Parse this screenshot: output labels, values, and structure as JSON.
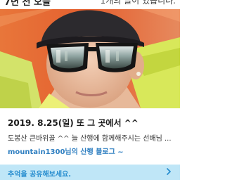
{
  "header": {
    "left_text": "7년 전 오늘",
    "right_text": "1개의 글이 있습니다."
  },
  "post": {
    "title": "2019. 8.25(일) 또  그 곳에서 ^^",
    "description": "도봉산 큰바위골 ^^ 늘 산행에 함께해주시는 선배님 ...",
    "blog_link": "mountain1300님의 산행 블로그 ~"
  },
  "share": {
    "label": "추억을 공유해보세요."
  }
}
